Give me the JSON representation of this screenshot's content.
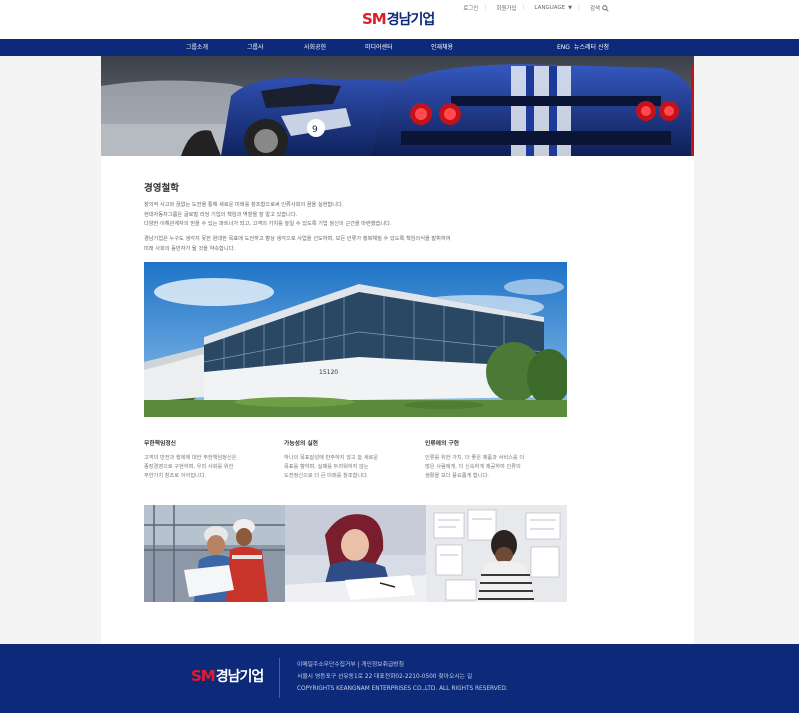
{
  "header": {
    "logo_sm": "SM",
    "logo_kr": "경남기업",
    "util": {
      "login": "로그인",
      "join": "회원가입",
      "language": "LANGUAGE",
      "search": "검색"
    }
  },
  "nav": {
    "items": [
      "그룹소개",
      "그룹사",
      "사회공헌",
      "미디어센터",
      "인재채용"
    ],
    "right_items": [
      "ENG",
      "뉴스레터 신청"
    ]
  },
  "content": {
    "title": "경영철학",
    "para1_line1": "창의적 사고와 끊없는 도전을 통해 새로운 미래를 창조함으로써 인류사회의 꿈을 실현합니다.",
    "para1_line2": "현대자동차그룹은 글로벌 리딩 기업의 책임과 역할을 잘 알고 있습니다.",
    "para1_line3": "다양한 이해관계자의 믿을 수 있는 파트너가 되고, 고객의 가치를 높일 수 있도록 기업 정신의 근간을 마련했습니다.",
    "para2_line1": "경남기업은 누구도 생각지 못한 원대한 목표에 도전하고 향상 생각으로 사업을 선도하며, 모든 인류가 행복해질 수 있도록 책임의식을 발휘하여",
    "para2_line2": "미래 사회의 동반자가 될 것을 약속합니다.",
    "columns": [
      {
        "title": "무한책임정신",
        "lines": [
          "고객의 만전과 행복에 대한 무한책임정신은",
          "종장경영으로 구현하며, 우리 사회를 위한",
          "무한가치 창조로 이어집니다."
        ]
      },
      {
        "title": "가능성의 실현",
        "lines": [
          "하나의 목표달성에 만주하지 않고 늘 새로운",
          "목표를 향하며, 실패를 두려워하지 않는",
          "도전정신으로 더 큰 미래를 창조합니다."
        ]
      },
      {
        "title": "인류에의 구현",
        "lines": [
          "인류를 위한 가치, 더 좋은 제품과 서비스를 더",
          "많은 사람에게, 더 신속하게 제공하여 인류의",
          "생활을 보다 풍요롭게 합니다."
        ]
      }
    ],
    "building_sign": "15120"
  },
  "footer": {
    "logo_sm": "SM",
    "logo_kr": "경남기업",
    "line1": "이메일주소무단수집거부 | 개인정보취급방침",
    "line2": "서울시 영등포구 선유동1로 22     대표전화02-2210-0500  찾아오시는 길",
    "line3": "COPYRIGHTS KEANGNAM  ENTERPRISES CO.,LTD. ALL  RIGHTS RESERVED."
  },
  "colors": {
    "brand_navy": "#0d2a7a",
    "brand_red": "#e11c2a"
  }
}
